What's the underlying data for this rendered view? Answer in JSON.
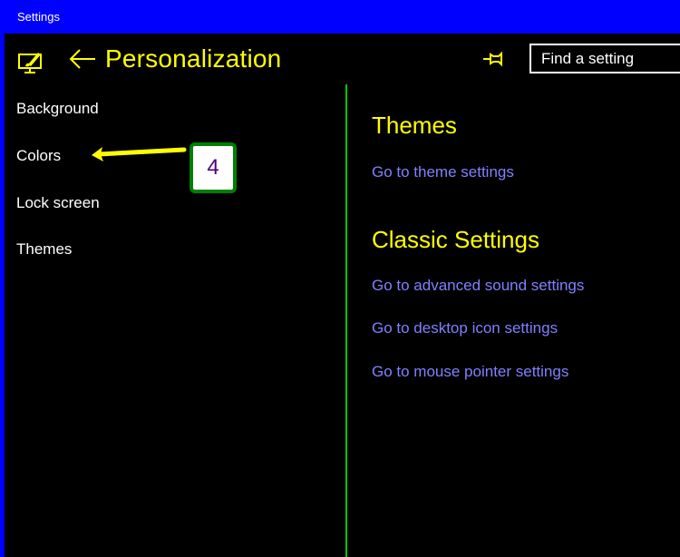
{
  "window": {
    "title": "Settings"
  },
  "header": {
    "icon": "personalization-icon",
    "back_icon": "back-arrow-icon",
    "title": "Personalization",
    "pin_icon": "pin-icon",
    "search": {
      "placeholder": "Find a setting",
      "value": ""
    }
  },
  "sidebar": {
    "items": [
      {
        "label": "Background"
      },
      {
        "label": "Colors"
      },
      {
        "label": "Lock screen"
      },
      {
        "label": "Themes"
      }
    ]
  },
  "content": {
    "sections": [
      {
        "title": "Themes",
        "links": [
          {
            "label": "Go to theme settings"
          }
        ]
      },
      {
        "title": "Classic Settings",
        "links": [
          {
            "label": "Go to advanced sound settings"
          },
          {
            "label": "Go to desktop icon settings"
          },
          {
            "label": "Go to mouse pointer settings"
          }
        ]
      }
    ]
  },
  "annotation": {
    "step_number": "4",
    "points_to": "Colors"
  },
  "colors": {
    "titlebar": "#0000ff",
    "background": "#000000",
    "accent_yellow": "#ffff00",
    "link": "#8080ff",
    "divider": "#00c800",
    "text": "#ffffff",
    "badge_border": "#008000",
    "badge_text": "#4b0082"
  }
}
